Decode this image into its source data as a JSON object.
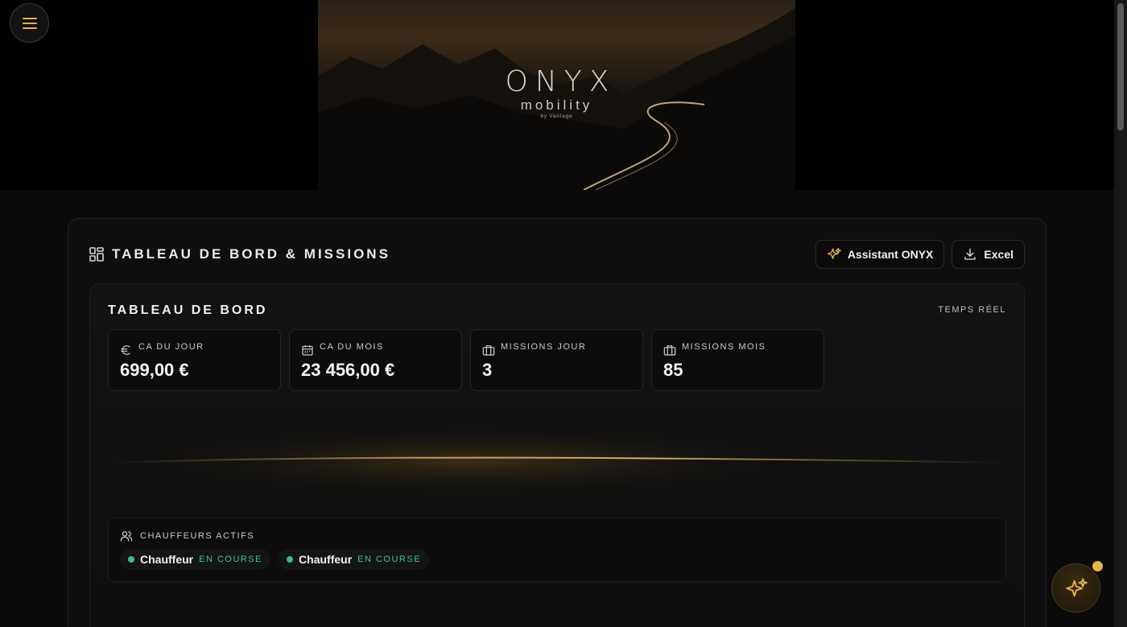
{
  "brand": {
    "name": "ONYX",
    "tagline": "mobility",
    "byline": "by Vantage"
  },
  "header": {
    "title": "TABLEAU DE BORD & MISSIONS",
    "actions": {
      "assistant_label": "Assistant ONYX",
      "excel_label": "Excel"
    }
  },
  "dashboard": {
    "title": "TABLEAU DE BORD",
    "live_label": "TEMPS RÉEL",
    "stats": [
      {
        "label": "CA DU JOUR",
        "value": "699,00 €",
        "icon": "euro-icon"
      },
      {
        "label": "CA DU MOIS",
        "value": "23 456,00 €",
        "icon": "calendar-icon"
      },
      {
        "label": "MISSIONS JOUR",
        "value": "3",
        "icon": "briefcase-icon"
      },
      {
        "label": "MISSIONS MOIS",
        "value": "85",
        "icon": "briefcase-icon"
      }
    ]
  },
  "drivers": {
    "title": "CHAUFFEURS ACTIFS",
    "items": [
      {
        "name": "Chauffeur",
        "status": "EN COURSE"
      },
      {
        "name": "Chauffeur",
        "status": "EN COURSE"
      }
    ]
  },
  "colors": {
    "accent_gold": "#e9b448",
    "status_green": "#33c481",
    "background": "#0a0a0a"
  }
}
